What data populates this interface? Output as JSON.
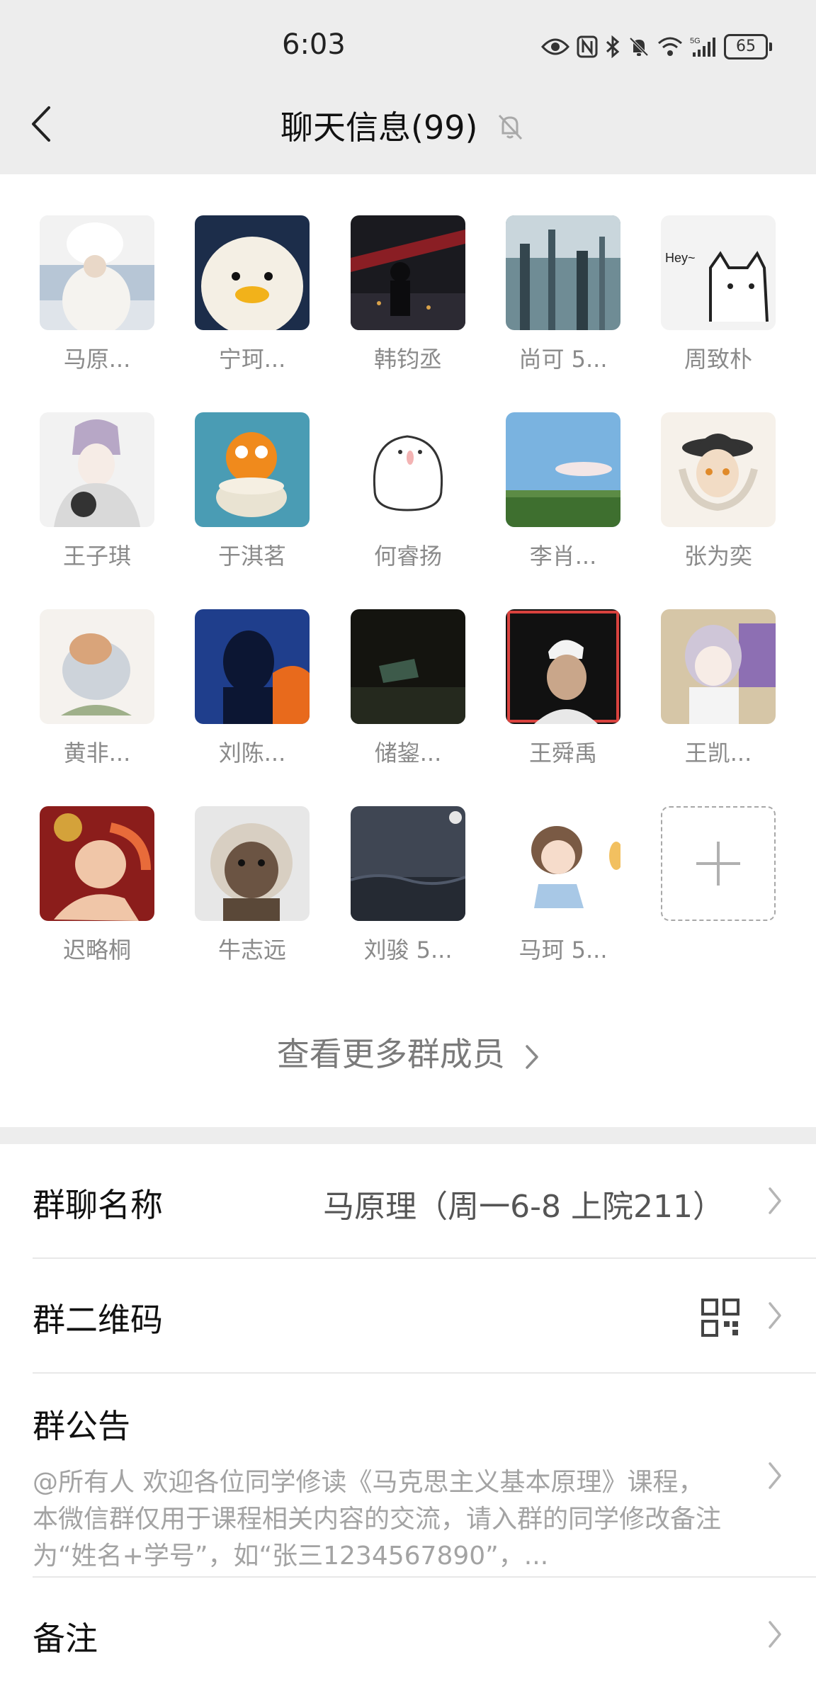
{
  "status_bar": {
    "time": "6:03",
    "battery": "65"
  },
  "header": {
    "title": "聊天信息(99)"
  },
  "members": [
    {
      "name": "马原..."
    },
    {
      "name": "宁珂..."
    },
    {
      "name": "韩钧丞"
    },
    {
      "name": "尚可 5..."
    },
    {
      "name": "周致朴"
    },
    {
      "name": "王子琪"
    },
    {
      "name": "于淇茗"
    },
    {
      "name": "何睿扬"
    },
    {
      "name": "李肖..."
    },
    {
      "name": "张为奕"
    },
    {
      "name": "黄非..."
    },
    {
      "name": "刘陈..."
    },
    {
      "name": "储鋆..."
    },
    {
      "name": "王舜禹"
    },
    {
      "name": "王凯..."
    },
    {
      "name": "迟略桐"
    },
    {
      "name": "牛志远"
    },
    {
      "name": "刘骏 5..."
    },
    {
      "name": "马珂 5..."
    }
  ],
  "avatar_texts": {
    "cat_hey": "Hey~"
  },
  "view_more": "查看更多群成员",
  "settings": {
    "group_name": {
      "label": "群聊名称",
      "value": "马原理（周一6-8 上院211）"
    },
    "qr_code": {
      "label": "群二维码"
    },
    "announcement": {
      "label": "群公告",
      "text": "@所有人 欢迎各位同学修读《马克思主义基本原理》课程，本微信群仅用于课程相关内容的交流，请入群的同学修改备注为“姓名+学号”，如“张三1234567890”，..."
    },
    "remark": {
      "label": "备注"
    }
  },
  "colors": {
    "header_bg": "#ededed",
    "secondary_text": "#8a8a8a",
    "divider": "#e8e8e8"
  }
}
